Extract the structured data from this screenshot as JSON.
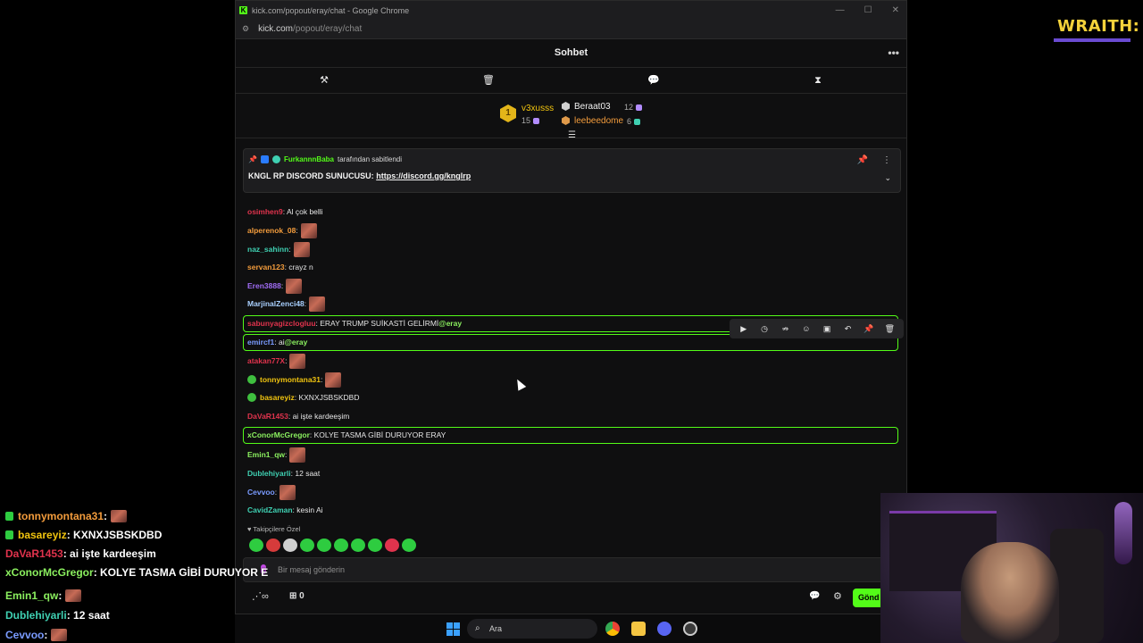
{
  "window": {
    "title": "kick.com/popout/eray/chat - Google Chrome",
    "url_host": "kick.com",
    "url_path": "/popout/eray/chat"
  },
  "chat": {
    "header_title": "Sohbet",
    "leaderboard": [
      {
        "rank": "1",
        "name": "v3xusss",
        "count": "15"
      },
      {
        "name": "Beraat03",
        "count": "12"
      },
      {
        "name": "leebeedome",
        "count": "6"
      }
    ],
    "pinned": {
      "pinned_by": "FurkannnBaba",
      "pinned_suffix": "tarafından sabitlendi",
      "message_prefix": "KNGL RP DISCORD SUNUCUSU:",
      "link": "https://discord.gg/knglrp"
    },
    "messages": [
      {
        "user": "osimhen9",
        "text": ": Al çok belli",
        "color": "#e0334d"
      },
      {
        "user": "alperenok_08",
        "text": ":",
        "color": "#f39c3c",
        "emote": true
      },
      {
        "user": "naz_sahinn",
        "text": ":",
        "color": "#3fd0b2",
        "emote": true
      },
      {
        "user": "servan123",
        "text": ": crayz n",
        "color": "#f39c3c"
      },
      {
        "user": "Eren3888",
        "text": ":",
        "color": "#a06cf5",
        "emote": true
      },
      {
        "user": "MarjinalZenci48",
        "text": ":",
        "color": "#a9d0ff",
        "emote": true
      },
      {
        "user": "sabunyagizclogluu",
        "text": ": ERAY TRUMP SUİKASTİ GELİRMİ",
        "mention": "@eray",
        "color": "#e0334d"
      },
      {
        "user": "emircf1",
        "text": ": ai",
        "mention": "@eray",
        "color": "#7a9bff"
      },
      {
        "user": "atakan77X",
        "text": ":",
        "color": "#e0334d",
        "emote": true
      },
      {
        "user": "tonnymontana31",
        "text": ":",
        "color": "#f1c40f",
        "emote": true,
        "badge": true
      },
      {
        "user": "basareyiz",
        "text": ": KXNXJSBSKDBD",
        "color": "#f1c40f",
        "badge": true
      },
      {
        "user": "DaVaR1453",
        "text": ": ai işte kardeeşim",
        "color": "#e0334d"
      },
      {
        "user": "xConorMcGregor",
        "text": ": KOLYE TASMA GİBİ DURUYOR ERAY",
        "color": "#8bf05f"
      },
      {
        "user": "Emin1_qw",
        "text": ":",
        "color": "#8bf05f",
        "emote": true
      },
      {
        "user": "Dublehiyarli",
        "text": ": 12 saat",
        "color": "#3fd0b2"
      },
      {
        "user": "Cevvoo",
        "text": ":",
        "color": "#7a9bff",
        "emote": true
      },
      {
        "user": "CavidZaman",
        "text": ": kesin Ai",
        "color": "#3fd0b2"
      }
    ],
    "follower_only_label": "Takipçilere Özel",
    "input_placeholder": "Bir mesaj gönderin",
    "points": "0",
    "send_label": "Gönd"
  },
  "overlay_chat": [
    {
      "user": "tonnymontana31",
      "text": " :",
      "emote": true,
      "color": "#f39c3c"
    },
    {
      "user": "basareyiz",
      "text": " : KXNXJSBSKDBD",
      "color": "#f1c40f"
    },
    {
      "user": "DaVaR1453",
      "text": " : ai işte kardeeşim",
      "color": "#e0334d"
    },
    {
      "user": "xConorMcGregor",
      "text": " : KOLYE TASMA GİBİ DURUYOR E",
      "color": "#8bf05f"
    },
    {
      "user": "Emin1_qw",
      "text": " :",
      "emote": true,
      "color": "#8bf05f"
    },
    {
      "user": "Dublehiyarli",
      "text": " : 12 saat",
      "color": "#3fd0b2"
    },
    {
      "user": "Cevvoo",
      "text": " :",
      "emote": true,
      "color": "#7a9bff"
    }
  ],
  "logo_text": "WRAITH:",
  "taskbar": {
    "search_label": "Ara"
  },
  "colors": {
    "accent": "#53fc18",
    "highlight_border": "#53fc18",
    "leaderboard_gold": "#f1c40f",
    "logo_yellow": "#f4d23b",
    "logo_purple": "#6a4bd1"
  }
}
